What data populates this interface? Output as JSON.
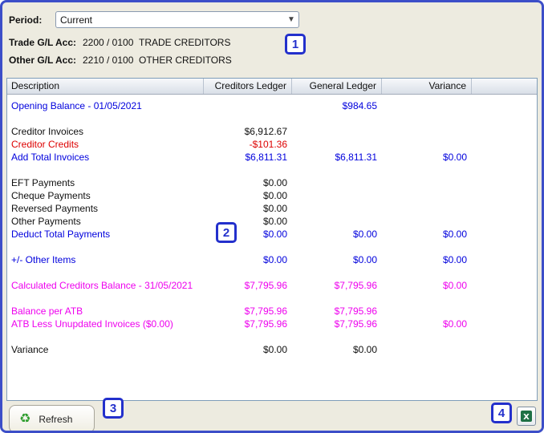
{
  "colors": {
    "window_border": "#3c4ec8",
    "annotation_blue": "#2330cc",
    "text_blue": "#0000dd",
    "text_red": "#dd0000",
    "text_magenta": "#ee00ee",
    "refresh_green": "#2f9e2f",
    "excel_green": "#1e7145"
  },
  "icons": {
    "dropdown_arrow": "▼",
    "refresh": "♻",
    "excel_letter": "X"
  },
  "period": {
    "label": "Period:",
    "value": "Current"
  },
  "accounts": [
    {
      "label": "Trade G/L Acc:",
      "code": "2200",
      "branch": "/ 0100",
      "name": "TRADE CREDITORS"
    },
    {
      "label": "Other G/L Acc:",
      "code": "2210",
      "branch": "/ 0100",
      "name": "OTHER CREDITORS"
    }
  ],
  "table": {
    "headers": [
      "Description",
      "Creditors Ledger",
      "General Ledger",
      "Variance"
    ],
    "rows": [
      {
        "desc": "Opening Balance - 01/05/2021",
        "creditors": "",
        "general": "$984.65",
        "variance": "",
        "style": "info"
      },
      {
        "desc": "",
        "creditors": "",
        "general": "",
        "variance": "",
        "style": "blank"
      },
      {
        "desc": "Creditor Invoices",
        "creditors": "$6,912.67",
        "general": "",
        "variance": "",
        "style": "normal"
      },
      {
        "desc": "Creditor Credits",
        "creditors": "-$101.36",
        "general": "",
        "variance": "",
        "style": "negative"
      },
      {
        "desc": "Add Total Invoices",
        "creditors": "$6,811.31",
        "general": "$6,811.31",
        "variance": "$0.00",
        "style": "info"
      },
      {
        "desc": "",
        "creditors": "",
        "general": "",
        "variance": "",
        "style": "blank"
      },
      {
        "desc": "EFT Payments",
        "creditors": "$0.00",
        "general": "",
        "variance": "",
        "style": "normal"
      },
      {
        "desc": "Cheque Payments",
        "creditors": "$0.00",
        "general": "",
        "variance": "",
        "style": "normal"
      },
      {
        "desc": "Reversed Payments",
        "creditors": "$0.00",
        "general": "",
        "variance": "",
        "style": "normal"
      },
      {
        "desc": "Other Payments",
        "creditors": "$0.00",
        "general": "",
        "variance": "",
        "style": "normal"
      },
      {
        "desc": "Deduct Total Payments",
        "creditors": "$0.00",
        "general": "$0.00",
        "variance": "$0.00",
        "style": "info"
      },
      {
        "desc": "",
        "creditors": "",
        "general": "",
        "variance": "",
        "style": "blank"
      },
      {
        "desc": "+/- Other Items",
        "creditors": "$0.00",
        "general": "$0.00",
        "variance": "$0.00",
        "style": "info"
      },
      {
        "desc": "",
        "creditors": "",
        "general": "",
        "variance": "",
        "style": "blank"
      },
      {
        "desc": "Calculated Creditors Balance - 31/05/2021",
        "creditors": "$7,795.96",
        "general": "$7,795.96",
        "variance": "$0.00",
        "style": "result"
      },
      {
        "desc": "",
        "creditors": "",
        "general": "",
        "variance": "",
        "style": "blank"
      },
      {
        "desc": "Balance per ATB",
        "creditors": "$7,795.96",
        "general": "$7,795.96",
        "variance": "",
        "style": "result"
      },
      {
        "desc": "ATB Less Unupdated Invoices ($0.00)",
        "creditors": "$7,795.96",
        "general": "$7,795.96",
        "variance": "$0.00",
        "style": "result"
      },
      {
        "desc": "",
        "creditors": "",
        "general": "",
        "variance": "",
        "style": "blank"
      },
      {
        "desc": "Variance",
        "creditors": "$0.00",
        "general": "$0.00",
        "variance": "",
        "style": "normal"
      }
    ]
  },
  "annotations": {
    "badges": [
      "1",
      "2",
      "3",
      "4"
    ]
  },
  "footer": {
    "refresh_label": "Refresh"
  }
}
